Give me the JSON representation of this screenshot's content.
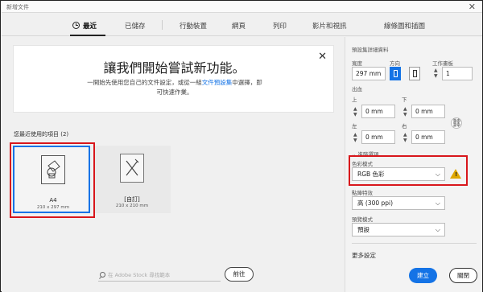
{
  "window": {
    "title": "新增文件",
    "close_glyph": "✕"
  },
  "tabs": [
    {
      "label": "最近",
      "icon": "clock-icon"
    },
    {
      "label": "已儲存"
    },
    {
      "label": "行動裝置"
    },
    {
      "label": "網頁"
    },
    {
      "label": "列印"
    },
    {
      "label": "影片和視訊"
    },
    {
      "label": "線條圖和插圖"
    }
  ],
  "hero": {
    "title": "讓我們開始嘗試新功能。",
    "text_before": "一開始先使用您自己的文件設定，或從一組",
    "link": "文件預設集",
    "text_after": "中選擇，即可快速作業。",
    "close_glyph": "✕"
  },
  "recent": {
    "label": "您最近使用的項目",
    "count": "(2)",
    "items": [
      {
        "name": "A4",
        "size": "210 x 297 mm",
        "selected": true
      },
      {
        "name": "[自訂]",
        "size": "210 x 210 mm",
        "selected": false
      }
    ]
  },
  "stock": {
    "placeholder": "在 Adobe Stock 尋找範本",
    "go": "前往"
  },
  "details": {
    "header": "預設集詳細資料",
    "width_label": "寬度",
    "width_value": "297 mm",
    "orientation_label": "方向",
    "artboards_label": "工作畫板",
    "artboards_value": "1",
    "bleed_label": "出血",
    "top_label": "上",
    "top_value": "0 mm",
    "bottom_label": "下",
    "bottom_value": "0 mm",
    "left_label": "左",
    "left_value": "0 mm",
    "right_label": "右",
    "right_value": "0 mm",
    "advanced_label": "進階選項",
    "color_mode_label": "色彩模式",
    "color_mode_value": "RGB 色彩",
    "raster_label": "點陣特效",
    "raster_value": "高 (300 ppi)",
    "preview_label": "預覽模式",
    "preview_value": "預設",
    "more_settings": "更多設定",
    "create": "建立",
    "close": "關閉"
  },
  "colors": {
    "accent": "#1473e6",
    "highlight": "#d8161b",
    "warning": "#e0a800"
  }
}
